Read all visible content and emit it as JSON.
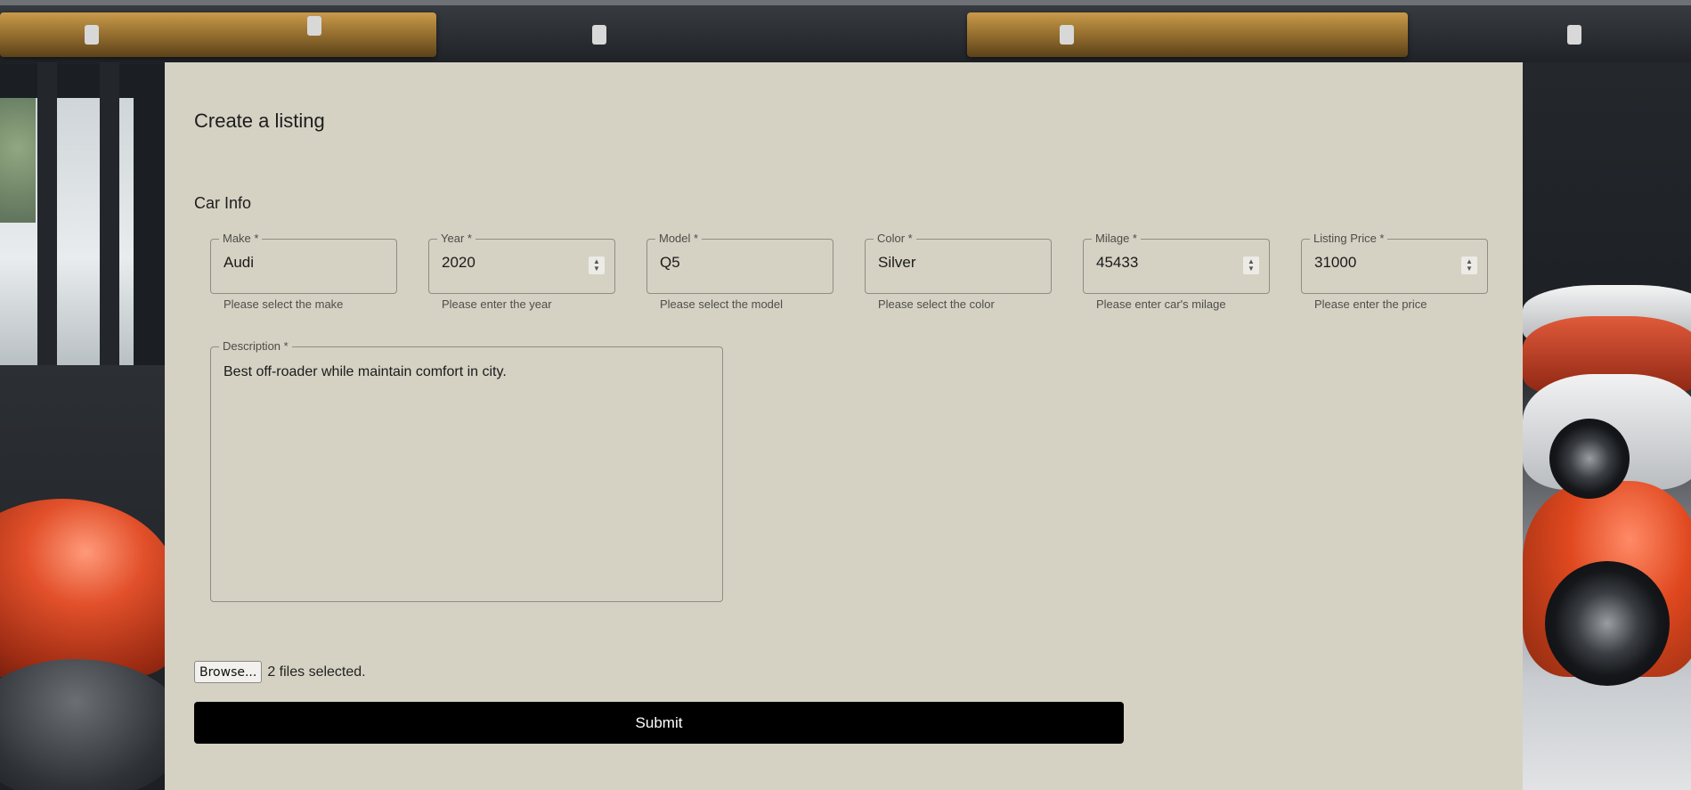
{
  "page": {
    "title": "Create a listing"
  },
  "section": {
    "title": "Car Info"
  },
  "fields": [
    {
      "label": "Make *",
      "value": "Audi",
      "helper": "Please select the make",
      "spinner": false
    },
    {
      "label": "Year *",
      "value": "2020",
      "helper": "Please enter the year",
      "spinner": true
    },
    {
      "label": "Model *",
      "value": "Q5",
      "helper": "Please select the model",
      "spinner": false
    },
    {
      "label": "Color *",
      "value": "Silver",
      "helper": "Please select the color",
      "spinner": false
    },
    {
      "label": "Milage *",
      "value": "45433",
      "helper": "Please enter car's milage",
      "spinner": true
    },
    {
      "label": "Listing Price *",
      "value": "31000",
      "helper": "Please enter the price",
      "spinner": true
    }
  ],
  "description": {
    "label": "Description *",
    "value": "Best off-roader while maintain comfort in city."
  },
  "file_input": {
    "button_label": "Browse...",
    "status": "2 files selected."
  },
  "submit": {
    "label": "Submit"
  },
  "colors": {
    "panel": "#d5d2c4",
    "submit_bg": "#000000",
    "submit_text": "#ffffff"
  },
  "icons": {
    "spinner": "up-down-chevron-icon"
  }
}
